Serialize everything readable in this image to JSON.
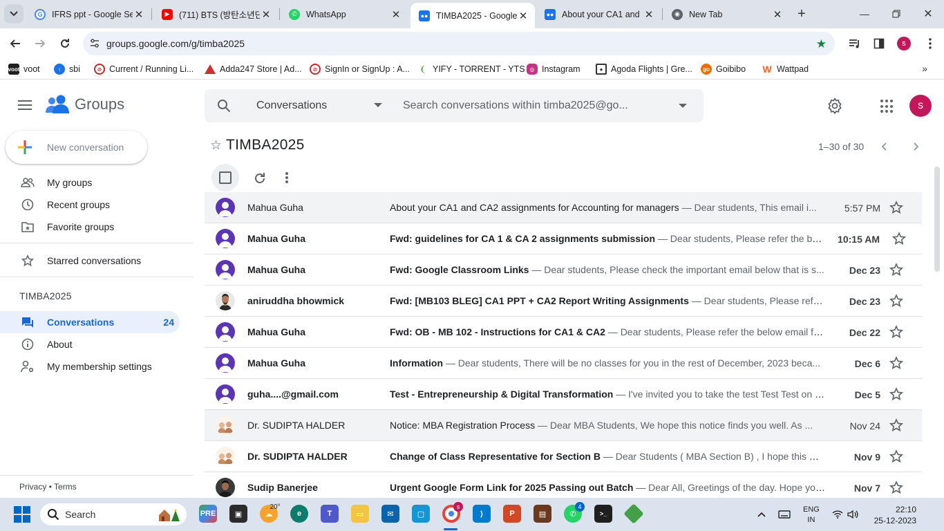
{
  "browser": {
    "tabs": [
      {
        "title": "IFRS ppt - Google Se",
        "favicon": "google-icon",
        "color": "#4285f4"
      },
      {
        "title": "(711) BTS (방탄소년단",
        "favicon": "youtube-icon",
        "color": "#ff0000"
      },
      {
        "title": "WhatsApp",
        "favicon": "whatsapp-icon",
        "color": "#25d366"
      },
      {
        "title": "TIMBA2025 - Google",
        "favicon": "groups-icon",
        "color": "#1a73e8",
        "active": true
      },
      {
        "title": "About your CA1 and",
        "favicon": "groups-icon",
        "color": "#1a73e8"
      },
      {
        "title": "New Tab",
        "favicon": "chrome-icon",
        "color": "#5f6368"
      }
    ],
    "url": "groups.google.com/g/timba2025",
    "profile_initial": "s",
    "bookmarks": [
      {
        "label": "voot",
        "icon": "voot-icon",
        "color": "#1f1f1f"
      },
      {
        "label": "sbi",
        "icon": "sbi-icon",
        "color": "#1a73e8"
      },
      {
        "label": "Current / Running Li...",
        "icon": "blocked-icon",
        "color": "#c62828"
      },
      {
        "label": "Adda247 Store | Ad...",
        "icon": "adda-icon",
        "color": "#d32f2f"
      },
      {
        "label": "SignIn or SignUp : A...",
        "icon": "blocked-icon",
        "color": "#c62828"
      },
      {
        "label": "YIFY - TORRENT - YTS",
        "icon": "yts-icon",
        "color": "#6ab04c"
      },
      {
        "label": "Instagram",
        "icon": "instagram-icon",
        "color": "#c13584"
      },
      {
        "label": "Agoda Flights | Gre...",
        "icon": "agoda-icon",
        "color": "#5f6368"
      },
      {
        "label": "Goibibo",
        "icon": "goibibo-icon",
        "color": "#ef6c00"
      },
      {
        "label": "Wattpad",
        "icon": "wattpad-icon",
        "color": "#ff6122"
      }
    ]
  },
  "header": {
    "product": "Groups",
    "search_scope": "Conversations",
    "search_placeholder": "Search conversations within timba2025@go...",
    "account_initial": "s"
  },
  "sidebar": {
    "new_conversation": "New conversation",
    "nav": [
      {
        "label": "My groups",
        "icon": "people-icon"
      },
      {
        "label": "Recent groups",
        "icon": "clock-icon"
      },
      {
        "label": "Favorite groups",
        "icon": "folder-star-icon"
      },
      {
        "label": "Starred conversations",
        "icon": "star-icon"
      }
    ],
    "group_name": "TIMBA2025",
    "group_nav": [
      {
        "label": "Conversations",
        "icon": "conversations-icon",
        "count": "24",
        "selected": true
      },
      {
        "label": "About",
        "icon": "info-icon"
      },
      {
        "label": "My membership settings",
        "icon": "person-settings-icon"
      }
    ],
    "footer": {
      "privacy": "Privacy",
      "separator": "•",
      "terms": "Terms"
    }
  },
  "main": {
    "title": "TIMBA2025",
    "pagination": "1–30 of 30",
    "conversations": [
      {
        "sender": "Mahua Guha",
        "subject": "About your CA1 and CA2 assignments for Accounting for managers",
        "snippet": " — Dear students, This email i...",
        "date": "5:57 PM",
        "unread": false,
        "avatar": "default"
      },
      {
        "sender": "Mahua Guha",
        "subject": "Fwd: guidelines for CA 1 & CA 2 assignments submission",
        "snippet": " — Dear students, Please refer the belo...",
        "date": "10:15 AM",
        "unread": true,
        "avatar": "default"
      },
      {
        "sender": "Mahua Guha",
        "subject": "Fwd: Google Classroom Links",
        "snippet": " — Dear students, Please check the important email below that is s...",
        "date": "Dec 23",
        "unread": true,
        "avatar": "default"
      },
      {
        "sender": "aniruddha bhowmick",
        "subject": "Fwd: [MB103 BLEG] CA1 PPT + CA2 Report Writing Assignments",
        "snippet": " — Dear students, Please refer t...",
        "date": "Dec 23",
        "unread": true,
        "avatar": "photo-man"
      },
      {
        "sender": "Mahua Guha",
        "subject": "Fwd: OB - MB 102 - Instructions for CA1 & CA2",
        "snippet": " — Dear students, Please refer the below email fro...",
        "date": "Dec 22",
        "unread": true,
        "avatar": "default"
      },
      {
        "sender": "Mahua Guha",
        "subject": "Information",
        "snippet": " — Dear students, There will be no classes for you in the rest of December, 2023 beca...",
        "date": "Dec 6",
        "unread": true,
        "avatar": "default"
      },
      {
        "sender": "guha....@gmail.com",
        "subject": "Test - Entrepreneurship & Digital Transformation",
        "snippet": " — I've invited you to take the test Test Test on E...",
        "date": "Dec 5",
        "unread": true,
        "avatar": "default"
      },
      {
        "sender": "Dr. SUDIPTA HALDER",
        "subject": "Notice: MBA Registration Process",
        "snippet": " — Dear MBA Students, We hope this notice finds you well. As ...",
        "date": "Nov 24",
        "unread": false,
        "avatar": "photo-illustration"
      },
      {
        "sender": "Dr. SUDIPTA HALDER",
        "subject": "Change of Class Representative for Section B",
        "snippet": " — Dear Students ( MBA Section B) , I hope this me...",
        "date": "Nov 9",
        "unread": true,
        "avatar": "photo-illustration"
      },
      {
        "sender": "Sudip Banerjee",
        "subject": "Urgent Google Form Link for 2025 Passing out Batch",
        "snippet": " — Dear All, Greetings of the day. Hope you ...",
        "date": "Nov 7",
        "unread": true,
        "avatar": "photo-man-dark"
      }
    ]
  },
  "taskbar": {
    "search_label": "Search",
    "weather": "20°",
    "chrome_badge": "s",
    "whatsapp_badge": "4",
    "language_line1": "ENG",
    "language_line2": "IN",
    "time": "22:10",
    "date": "25-12-2023"
  },
  "colors": {
    "accent": "#1a73e8",
    "selected_bg": "#e8f0fe",
    "avatar_default": "#5c35b5",
    "account": "#c2185b"
  }
}
